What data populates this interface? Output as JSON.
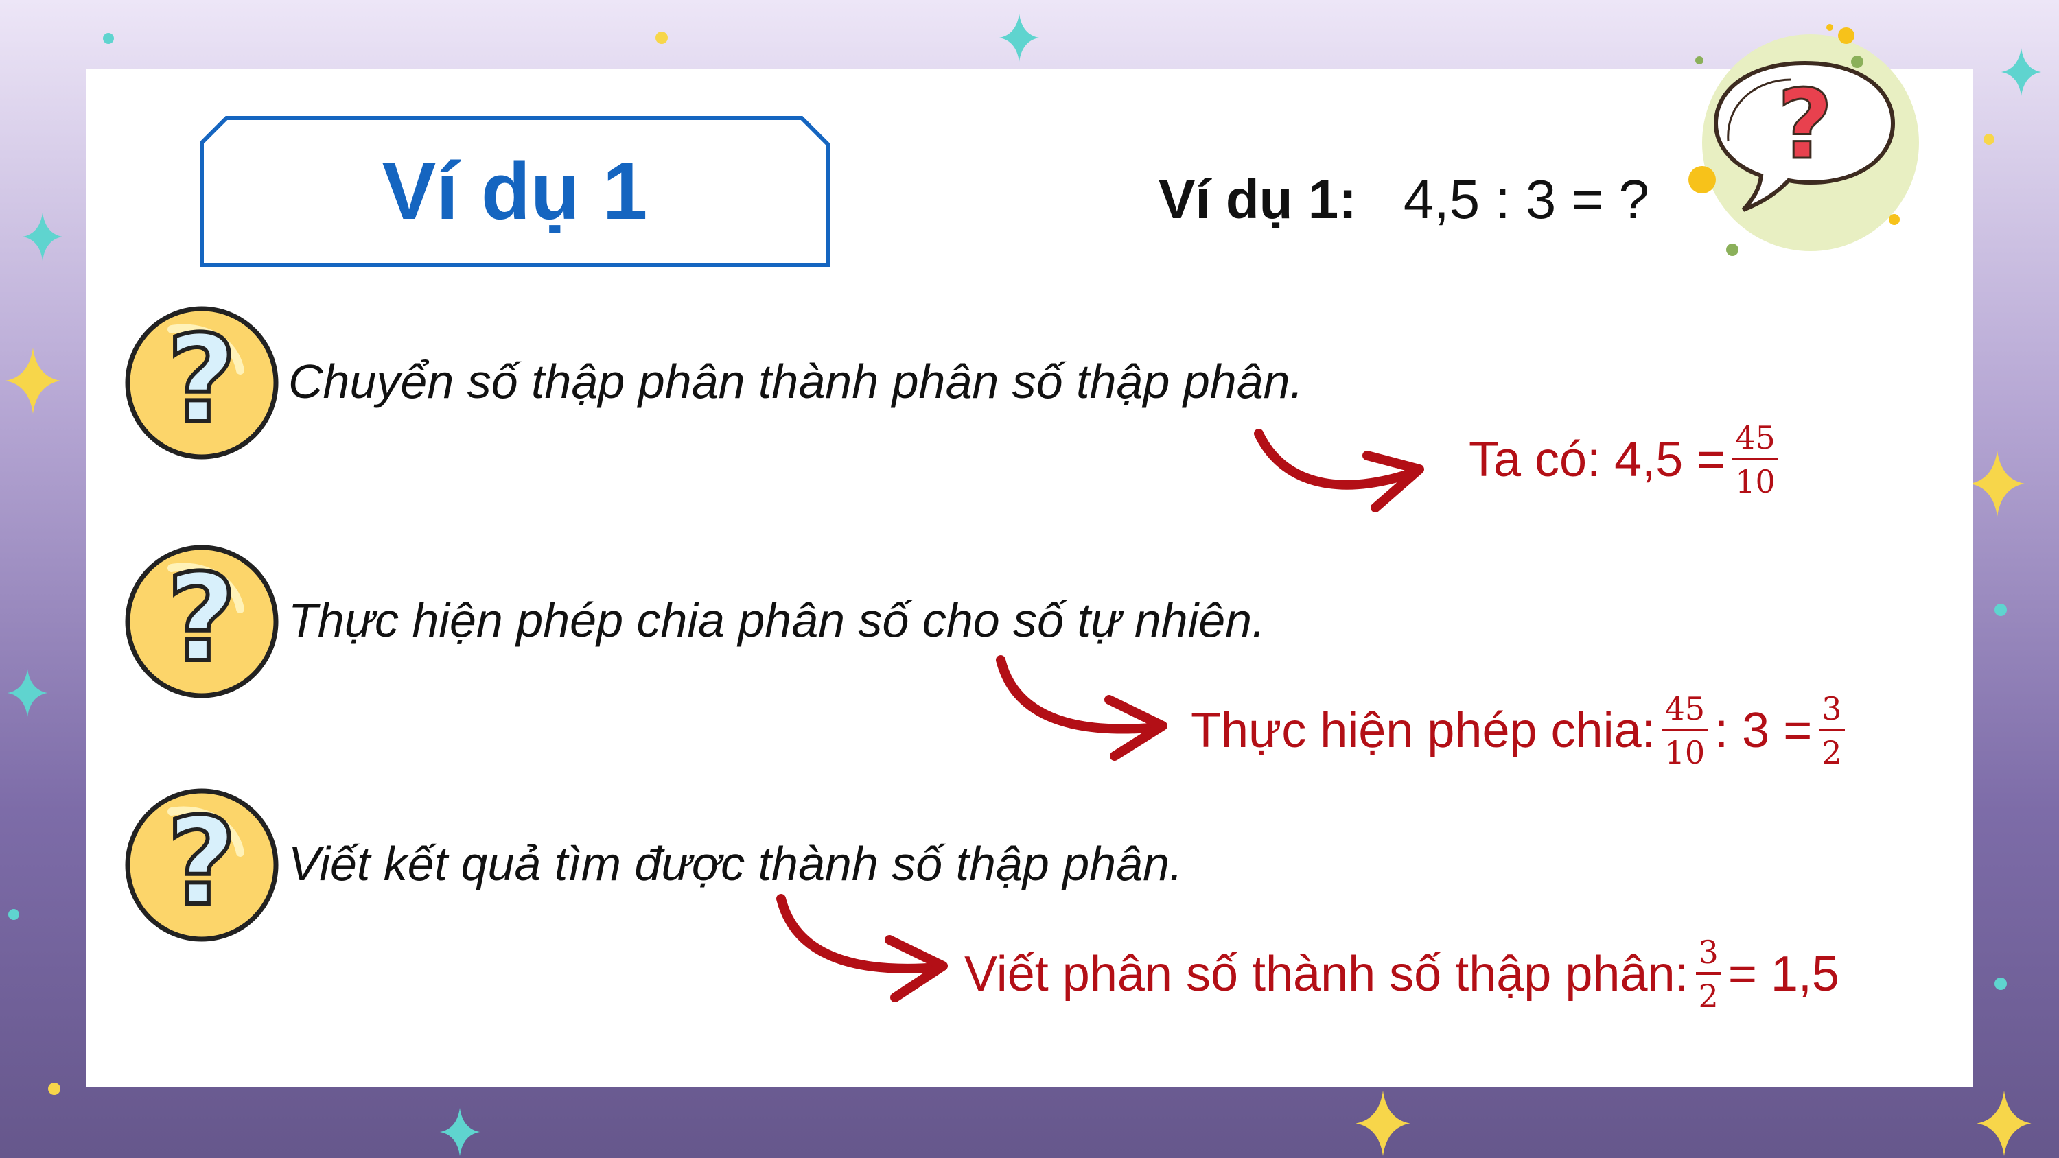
{
  "title_box": {
    "label": "Ví dụ 1"
  },
  "heading": {
    "label": "Ví dụ 1:",
    "expression": "4,5 : 3 = ?"
  },
  "colors": {
    "accent_blue": "#1565c0",
    "answer_red": "#b30f16",
    "icon_yellow": "#fcd56a"
  },
  "steps": [
    {
      "question": "Chuyển số thập phân thành phân số thập phân.",
      "answer_prefix": "Ta có: 4,5 =",
      "answer_frac_num": "45",
      "answer_frac_den": "10"
    },
    {
      "question": "Thực hiện phép chia phân số cho số tự nhiên.",
      "answer_prefix": "Thực hiện phép chia:",
      "frac1_num": "45",
      "frac1_den": "10",
      "middle": ": 3 =",
      "frac2_num": "3",
      "frac2_den": "2"
    },
    {
      "question": "Viết kết quả tìm được thành số thập phân.",
      "answer_prefix": "Viết phân số thành số thập phân:",
      "frac_num": "3",
      "frac_den": "2",
      "answer_suffix": "= 1,5"
    }
  ],
  "icons": {
    "step_icon": "question-mark-circle-icon",
    "corner_icon": "question-speech-bubble-icon",
    "arrow_icon": "curved-arrow-icon"
  }
}
